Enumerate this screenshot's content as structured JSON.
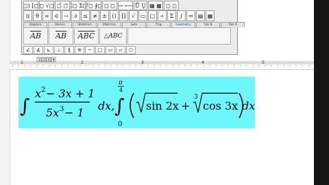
{
  "toolbar": {
    "row1": [
      {
        "glyph": "(◻) [◻]",
        "icon": "fence-templates-icon",
        "w": 22
      },
      {
        "glyph": "◻ √◻",
        "icon": "radical-templates-icon",
        "w": 22
      },
      {
        "glyph": "◻̄ ◻⃗",
        "icon": "overbar-templates-icon",
        "w": 22
      },
      {
        "glyph": "Σ◻ Σ◻",
        "icon": "summation-templates-icon",
        "w": 22
      },
      {
        "glyph": "∫◻ ∮◻",
        "icon": "integral-templates-icon",
        "w": 22
      },
      {
        "glyph": "◻ ◻",
        "icon": "underbar-templates-icon",
        "w": 22
      },
      {
        "glyph": "→ ⟵",
        "icon": "labeled-arrow-templates-icon",
        "w": 22
      },
      {
        "glyph": "Ů Ų",
        "icon": "product-templates-icon",
        "w": 20
      },
      {
        "glyph": "▦ ▦",
        "icon": "matrix-templates-icon",
        "w": 22
      },
      {
        "glyph": "◻ ◻",
        "icon": "box-templates-icon",
        "w": 22
      }
    ],
    "row2": [
      {
        "glyph": "π",
        "icon": "pi-icon",
        "w": 13
      },
      {
        "glyph": "θ",
        "icon": "theta-icon",
        "w": 13
      },
      {
        "glyph": "∞",
        "icon": "infinity-icon",
        "w": 13
      },
      {
        "glyph": "∈",
        "icon": "element-of-icon",
        "w": 13
      },
      {
        "glyph": "→",
        "icon": "arrow-icon",
        "w": 13
      },
      {
        "glyph": "∂",
        "icon": "partial-icon",
        "w": 13
      },
      {
        "glyph": "≤",
        "icon": "less-equal-icon",
        "w": 13
      },
      {
        "glyph": "≠",
        "icon": "not-equal-icon",
        "w": 13
      },
      {
        "glyph": "±",
        "icon": "plus-minus-icon",
        "w": 13
      },
      {
        "glyph": "()",
        "icon": "parentheses-icon",
        "w": 13
      },
      {
        "glyph": "[]",
        "icon": "brackets-icon",
        "w": 13
      },
      {
        "glyph": "√",
        "icon": "sqrt-icon",
        "w": 13
      },
      {
        "glyph": "▭",
        "icon": "fraction-icon",
        "w": 13
      },
      {
        "glyph": "□",
        "icon": "box-icon",
        "w": 13
      },
      {
        "glyph": "÷",
        "icon": "divide-icon",
        "w": 13
      },
      {
        "glyph": "Σ",
        "icon": "sigma-icon",
        "w": 13
      },
      {
        "glyph": "∫",
        "icon": "integral-icon",
        "w": 13
      },
      {
        "glyph": "⇒",
        "icon": "implies-icon",
        "w": 13
      },
      {
        "glyph": "▤",
        "icon": "matrix-icon",
        "w": 13
      },
      {
        "glyph": "▦",
        "icon": "table-icon",
        "w": 13
      }
    ],
    "tabs": [
      "Algebra",
      "Derivs",
      "Statistics",
      "Matrices",
      "Sets",
      "Trig",
      "Geometry",
      "Tab 8",
      "Tab 9"
    ],
    "active_tab": 6,
    "templates": [
      {
        "text": "AB",
        "overline": true,
        "icon": "segment-template-icon",
        "cls": ""
      },
      {
        "text": "AB",
        "overline": true,
        "icon": "ray-template-icon",
        "cls": ""
      },
      {
        "text": "ABC",
        "overline": true,
        "icon": "arc-template-icon",
        "cls": ""
      },
      {
        "text": "△ABC",
        "overline": false,
        "icon": "triangle-template-icon",
        "cls": "sm"
      }
    ],
    "shapes": [
      {
        "glyph": "∠",
        "icon": "angle-icon"
      },
      {
        "glyph": "∡",
        "icon": "measured-angle-icon"
      },
      {
        "glyph": "⊾",
        "icon": "right-angle-icon"
      },
      {
        "glyph": "⊥",
        "icon": "perpendicular-icon"
      },
      {
        "glyph": "∥",
        "icon": "parallel-icon"
      },
      {
        "glyph": "≅",
        "icon": "congruent-icon"
      },
      {
        "glyph": "~",
        "icon": "similar-icon"
      },
      {
        "glyph": "□",
        "icon": "square-icon"
      },
      {
        "glyph": "▭",
        "icon": "rectangle-icon"
      },
      {
        "glyph": "▱",
        "icon": "parallelogram-icon"
      },
      {
        "glyph": "○",
        "icon": "circle-icon"
      }
    ]
  },
  "ruler": {
    "numbers": [
      "1",
      "2",
      "3",
      "4",
      "5"
    ],
    "page_marks": [
      "1",
      "2",
      "3",
      "4"
    ]
  },
  "equation": {
    "integral1": "∫",
    "num": [
      "x",
      "2",
      " − 3x + 1"
    ],
    "den": [
      "5x",
      "3",
      " − 1"
    ],
    "dx1": "dx,",
    "integral2": "∫",
    "upper": "π",
    "upper_den": "4",
    "lower": "0",
    "sqrt_arg": "sin 2x",
    "plus": "+",
    "cbrt_index": "3",
    "cbrt_arg": "cos 3x",
    "dx2": "dx"
  }
}
